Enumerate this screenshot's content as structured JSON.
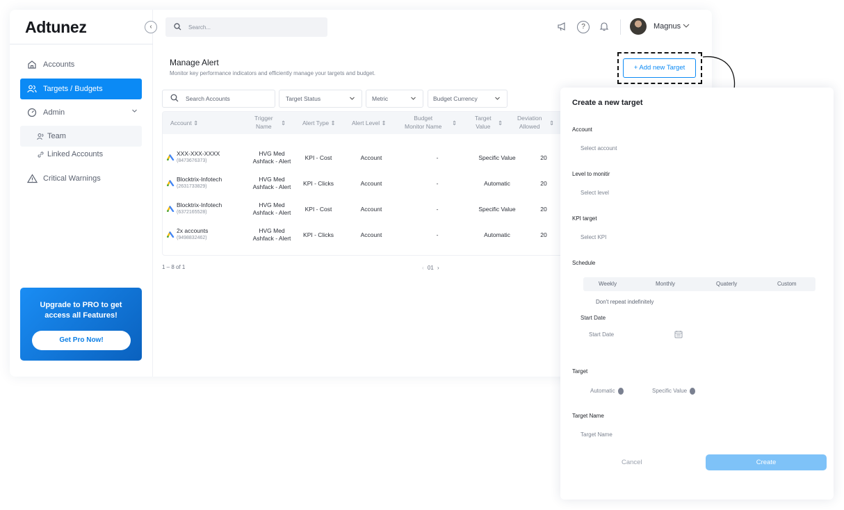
{
  "app": {
    "logo": "Adtunez"
  },
  "topbar": {
    "search_placeholder": "Search...",
    "user_name": "Magnus"
  },
  "sidebar": {
    "items": [
      {
        "label": "Accounts",
        "icon": "home-icon"
      },
      {
        "label": "Targets / Budgets",
        "icon": "users-icon",
        "active": true
      },
      {
        "label": "Admin",
        "icon": "gauge-icon"
      },
      {
        "label": "Team",
        "icon": "team-icon"
      },
      {
        "label": "Linked Accounts",
        "icon": "link-icon"
      },
      {
        "label": "Critical Warnings",
        "icon": "warning-icon"
      }
    ],
    "upgrade": {
      "line1": "Upgrade to  PRO to get",
      "line2": "access all Features!",
      "button": "Get Pro Now!"
    }
  },
  "main": {
    "title": "Manage Alert",
    "subtitle": "Monitor key performance indicators and efficiently manage your targets and budget.",
    "add_button": "+ Add new Target",
    "filters": {
      "search_placeholder": "Search Accounts",
      "status": "Target Status",
      "metric": "Metric",
      "currency": "Budget Currency"
    },
    "columns": {
      "account": "Account",
      "trigger_1": "Trigger",
      "trigger_2": "Name",
      "alert_type": "Alert Type",
      "alert_level": "Alert Level",
      "budget_1": "Budget",
      "budget_2": "Monitor Name",
      "target_1": "Target",
      "target_2": "Value",
      "deviation_1": "Deviation",
      "deviation_2": "Allowed"
    },
    "rows": [
      {
        "name": "XXX-XXX-XXXX",
        "id": "(8473676373)",
        "trigger_1": "HVG Med",
        "trigger_2": "Ashfack - Alert",
        "type": "KPI - Cost",
        "level": "Account",
        "budget": "-",
        "target": "Specific Value",
        "deviation": "20"
      },
      {
        "name": "Blocktrix-Infotech",
        "id": "(2631733829)",
        "trigger_1": "HVG Med",
        "trigger_2": "Ashfack - Alert",
        "type": "KPI - Clicks",
        "level": "Account",
        "budget": "-",
        "target": "Automatic",
        "deviation": "20"
      },
      {
        "name": "Blocktrix-Infotech",
        "id": "(6372165528)",
        "trigger_1": "HVG Med",
        "trigger_2": "Ashfack - Alert",
        "type": "KPI - Cost",
        "level": "Account",
        "budget": "-",
        "target": "Specific Value",
        "deviation": "20"
      },
      {
        "name": "2x accounts",
        "id": "(9498832462)",
        "trigger_1": "HVG Med",
        "trigger_2": "Ashfack - Alert",
        "type": "KPI - Clicks",
        "level": "Account",
        "budget": "-",
        "target": "Automatic",
        "deviation": "20"
      }
    ],
    "pagination": {
      "range": "1 – 8 of 1",
      "page": "01"
    }
  },
  "panel": {
    "title": "Create a new target",
    "account_label": "Account",
    "account_ph": "Select account",
    "level_label": "Level to monitir",
    "level_ph": "Select level",
    "kpi_label": "KPI target",
    "kpi_ph": "Select KPI",
    "schedule_label": "Schedule",
    "schedule_options": [
      "Weekly",
      "Monthly",
      "Quaterly",
      "Custom"
    ],
    "repeat": "Don't repeat indefinitely",
    "start_label": "Start Date",
    "start_ph": "Start Date",
    "target_label": "Target",
    "target_auto": "Automatic",
    "target_specific": "Specific Value",
    "name_label": "Target Name",
    "name_ph": "Target Name",
    "cancel": "Cancel",
    "create": "Create"
  }
}
